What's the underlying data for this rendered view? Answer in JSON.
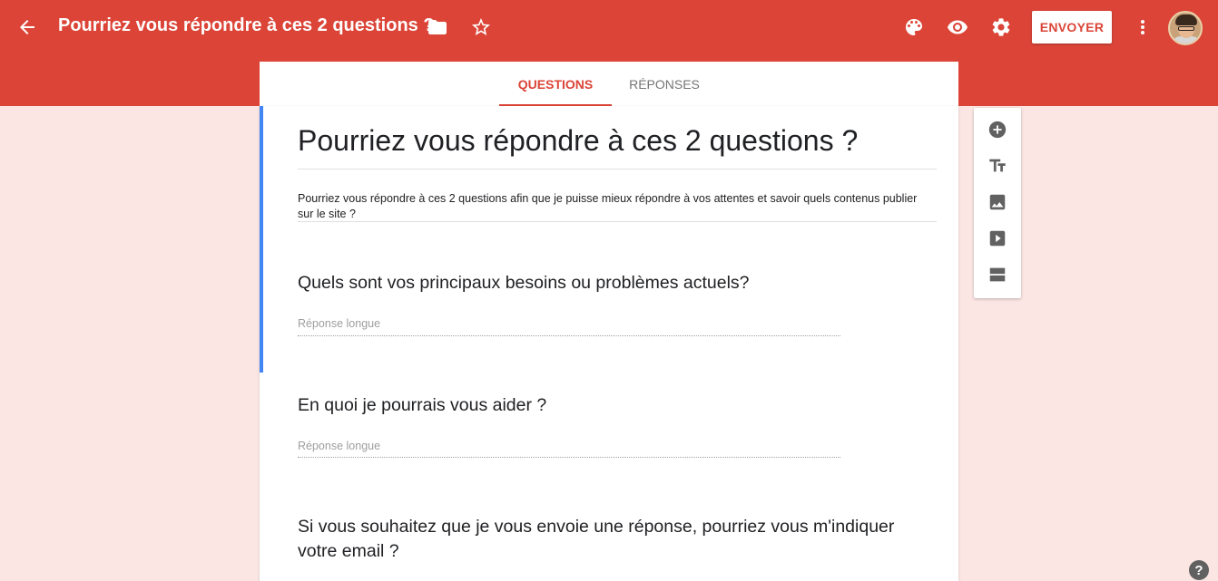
{
  "header": {
    "title": "Pourriez vous répondre à ces 2 questions ?",
    "send_label": "ENVOYER",
    "icons": {
      "back": "arrow-back-icon",
      "folder": "folder-icon",
      "star": "star-outline-icon",
      "palette": "palette-icon",
      "preview": "eye-icon",
      "settings": "gear-icon",
      "more": "more-vert-icon"
    },
    "brand_color": "#db4437"
  },
  "tabs": [
    {
      "label": "QUESTIONS",
      "active": true
    },
    {
      "label": "RÉPONSES",
      "active": false
    }
  ],
  "form": {
    "title": "Pourriez vous répondre à ces 2 questions ?",
    "description": "Pourriez vous répondre à ces 2 questions afin que je puisse mieux répondre à vos attentes et savoir quels contenus publier sur le site ?",
    "questions": [
      {
        "text": "Quels sont vos principaux besoins ou problèmes actuels?",
        "placeholder": "Réponse longue"
      },
      {
        "text": "En quoi je pourrais vous aider ?",
        "placeholder": "Réponse longue"
      },
      {
        "text": "Si vous souhaitez que je vous envoie une réponse, pourriez vous m'indiquer votre email ?"
      }
    ],
    "accent_color": "#4285f4"
  },
  "sidebar_tools": [
    "add-question-icon",
    "title-text-icon",
    "image-icon",
    "video-icon",
    "section-icon"
  ],
  "help_label": "?"
}
